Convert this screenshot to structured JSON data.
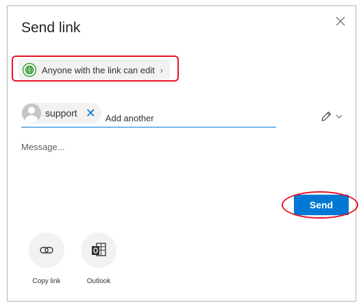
{
  "dialog": {
    "title": "Send link",
    "close_icon": "close-icon"
  },
  "permission": {
    "label": "Anyone with the link can edit",
    "chevron": "›",
    "icon": "globe-icon",
    "icon_color": "#107c10"
  },
  "recipients": {
    "chips": [
      {
        "name": "support",
        "remove_glyph": "✕"
      }
    ],
    "add_placeholder": "Add another"
  },
  "message": {
    "placeholder": "Message..."
  },
  "actions": {
    "send_label": "Send",
    "accent_color": "#0078d4"
  },
  "share_options": [
    {
      "label": "Copy link",
      "icon": "link-icon"
    },
    {
      "label": "Outlook",
      "icon": "outlook-icon"
    }
  ]
}
